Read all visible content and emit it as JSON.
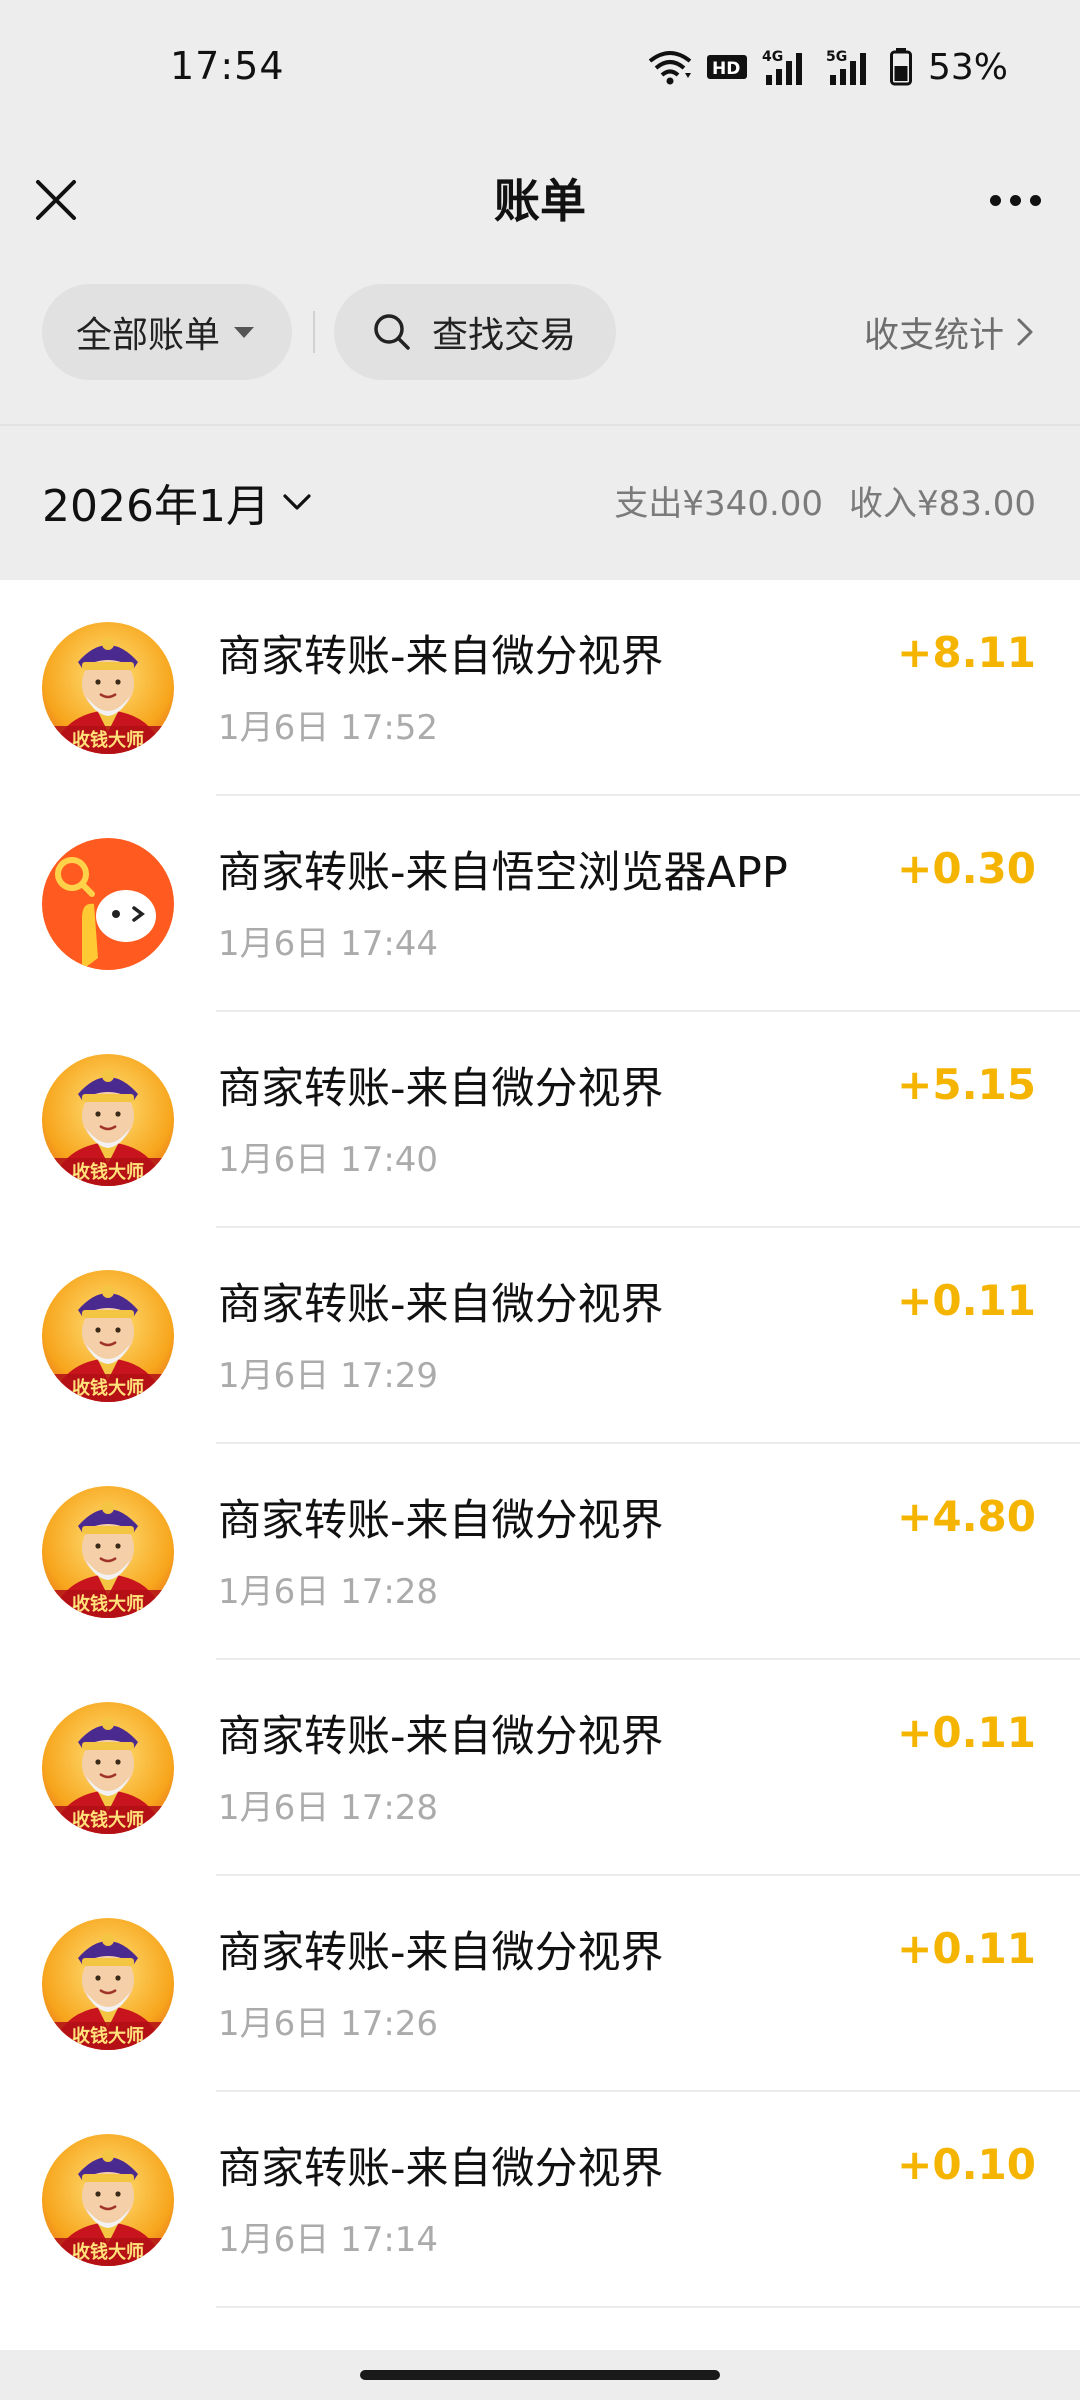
{
  "status_bar": {
    "time": "17:54",
    "hd_label": "HD",
    "net1": "4G",
    "net2": "5G",
    "battery": "53%"
  },
  "header": {
    "title": "账单"
  },
  "filters": {
    "all_bills": "全部账单",
    "search": "查找交易",
    "stats": "收支统计"
  },
  "month": {
    "label": "2026年1月",
    "expense": "支出¥340.00",
    "income": "收入¥83.00"
  },
  "transactions": [
    {
      "title": "商家转账-来自微分视界",
      "time": "1月6日 17:52",
      "amount": "+8.11",
      "avatar": "god-of-wealth"
    },
    {
      "title": "商家转账-来自悟空浏览器APP",
      "time": "1月6日 17:44",
      "amount": "+0.30",
      "avatar": "wukong-browser"
    },
    {
      "title": "商家转账-来自微分视界",
      "time": "1月6日 17:40",
      "amount": "+5.15",
      "avatar": "god-of-wealth"
    },
    {
      "title": "商家转账-来自微分视界",
      "time": "1月6日 17:29",
      "amount": "+0.11",
      "avatar": "god-of-wealth"
    },
    {
      "title": "商家转账-来自微分视界",
      "time": "1月6日 17:28",
      "amount": "+4.80",
      "avatar": "god-of-wealth"
    },
    {
      "title": "商家转账-来自微分视界",
      "time": "1月6日 17:28",
      "amount": "+0.11",
      "avatar": "god-of-wealth"
    },
    {
      "title": "商家转账-来自微分视界",
      "time": "1月6日 17:26",
      "amount": "+0.11",
      "avatar": "god-of-wealth"
    },
    {
      "title": "商家转账-来自微分视界",
      "time": "1月6日 17:14",
      "amount": "+0.10",
      "avatar": "god-of-wealth"
    }
  ],
  "avatar_text": "收钱大师",
  "colors": {
    "amount": "#f5b400",
    "background": "#ededed",
    "list_background": "#ffffff",
    "wukong_orange": "#ff5a1f"
  },
  "icons": [
    "close-icon",
    "more-icon",
    "search-icon",
    "caret-down-icon",
    "chevron-right-icon",
    "chevron-down-icon",
    "wifi-icon",
    "signal-icon",
    "battery-icon"
  ]
}
